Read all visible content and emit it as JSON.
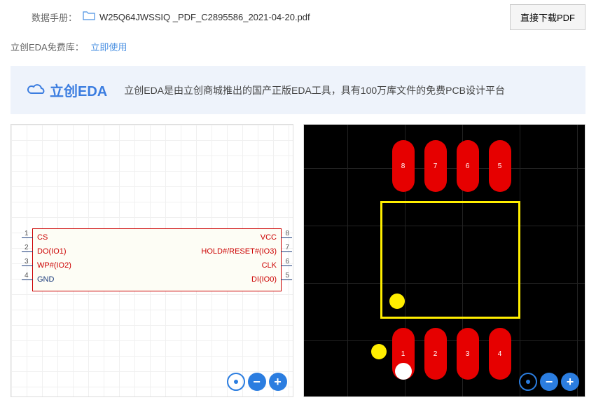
{
  "header": {
    "datasheet_label": "数据手册：",
    "filename": "W25Q64JWSSIQ _PDF_C2895586_2021-04-20.pdf",
    "download_button": "直接下载PDF"
  },
  "eda_row": {
    "prefix": "立创EDA免费库：",
    "link": "立即使用"
  },
  "banner": {
    "logo": "立创EDA",
    "text": "立创EDA是由立创商城推出的国产正版EDA工具，具有100万库文件的免费PCB设计平台"
  },
  "schematic": {
    "left_pins": [
      {
        "num": "1",
        "label": "CS"
      },
      {
        "num": "2",
        "label": "DO(IO1)"
      },
      {
        "num": "3",
        "label": "WP#(IO2)"
      },
      {
        "num": "4",
        "label": "GND"
      }
    ],
    "right_pins": [
      {
        "num": "8",
        "label": "VCC"
      },
      {
        "num": "7",
        "label": "HOLD#/RESET#(IO3)"
      },
      {
        "num": "6",
        "label": "CLK"
      },
      {
        "num": "5",
        "label": "DI(IO0)"
      }
    ]
  },
  "pcb": {
    "top_pads": [
      "8",
      "7",
      "6",
      "5"
    ],
    "bottom_pads": [
      "1",
      "2",
      "3",
      "4"
    ]
  }
}
